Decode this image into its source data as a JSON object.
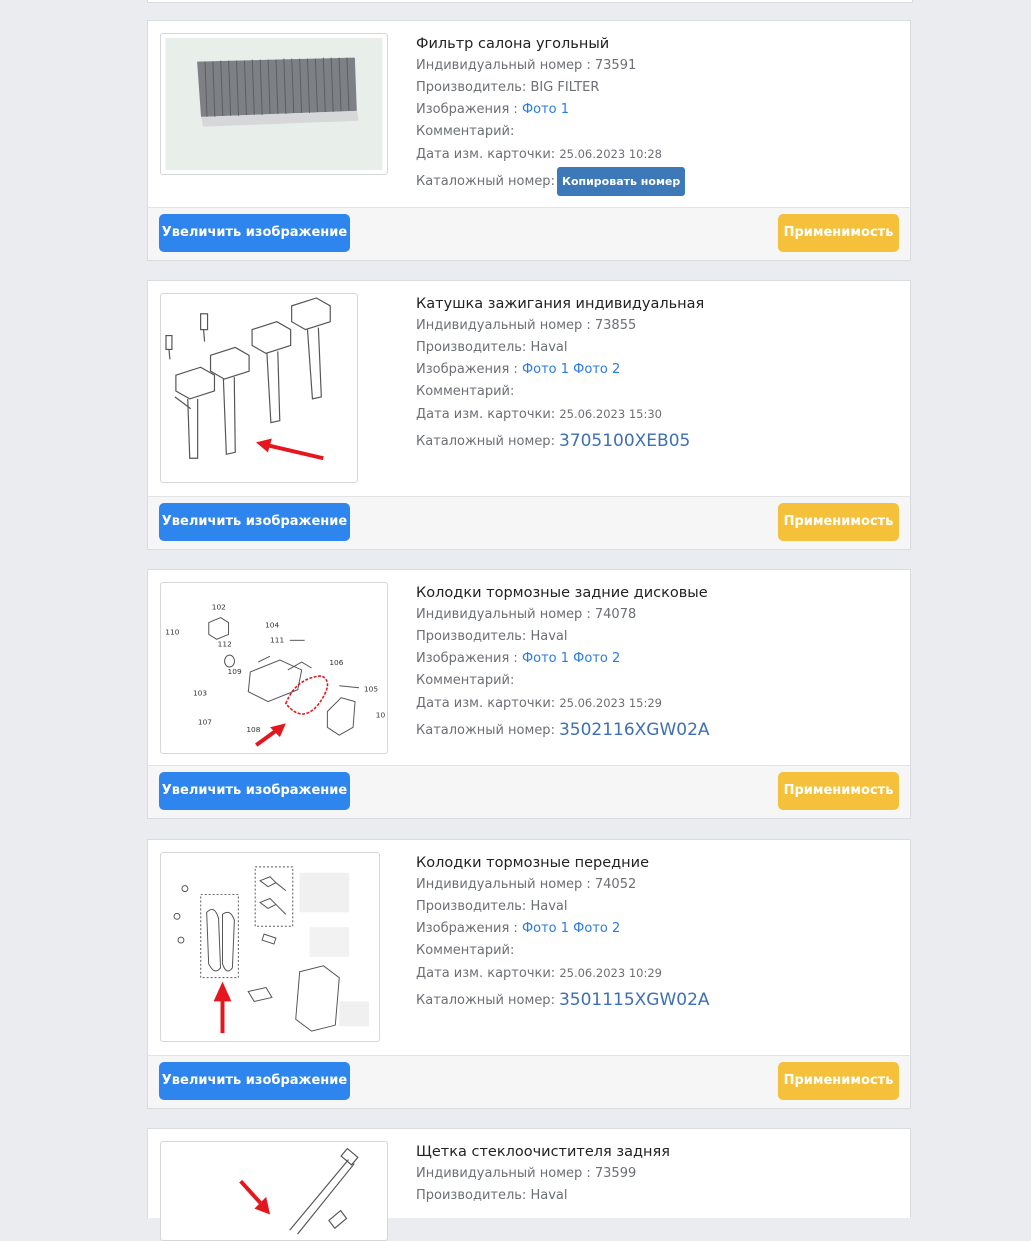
{
  "labels": {
    "individual_number": "Индивидуальный номер : ",
    "manufacturer": "Производитель: ",
    "images": "Изображения : ",
    "comment": "Комментарий:",
    "card_date": "Дата изм. карточки: ",
    "catalog_number": "Каталожный номер:",
    "copy_number": "Копировать номер",
    "zoom_image": "Увеличить изображение",
    "applicability": "Применимость"
  },
  "products": [
    {
      "title": "Фильтр салона угольный",
      "individual_number": "73591",
      "manufacturer": "BIG FILTER",
      "photo1": "Фото 1",
      "photo2": "",
      "card_date": "25.06.2023 10:28",
      "catalog_number": ""
    },
    {
      "title": "Катушка зажигания индивидуальная",
      "individual_number": "73855",
      "manufacturer": "Haval",
      "photo1": "Фото 1",
      "photo2": "Фото 2",
      "card_date": "25.06.2023 15:30",
      "catalog_number": "3705100XEB05"
    },
    {
      "title": "Колодки тормозные задние дисковые",
      "individual_number": "74078",
      "manufacturer": "Haval",
      "photo1": "Фото 1",
      "photo2": "Фото 2",
      "card_date": "25.06.2023 15:29",
      "catalog_number": "3502116XGW02A",
      "diagram_labels": [
        "102",
        "110",
        "112",
        "104",
        "111",
        "109",
        "106",
        "105",
        "103",
        "107",
        "108",
        "10"
      ]
    },
    {
      "title": "Колодки тормозные передние",
      "individual_number": "74052",
      "manufacturer": "Haval",
      "photo1": "Фото 1",
      "photo2": "Фото 2",
      "card_date": "25.06.2023 10:29",
      "catalog_number": "3501115XGW02A"
    },
    {
      "title": "Щетка стеклоочистителя задняя",
      "individual_number": "73599",
      "manufacturer": "Haval"
    }
  ]
}
